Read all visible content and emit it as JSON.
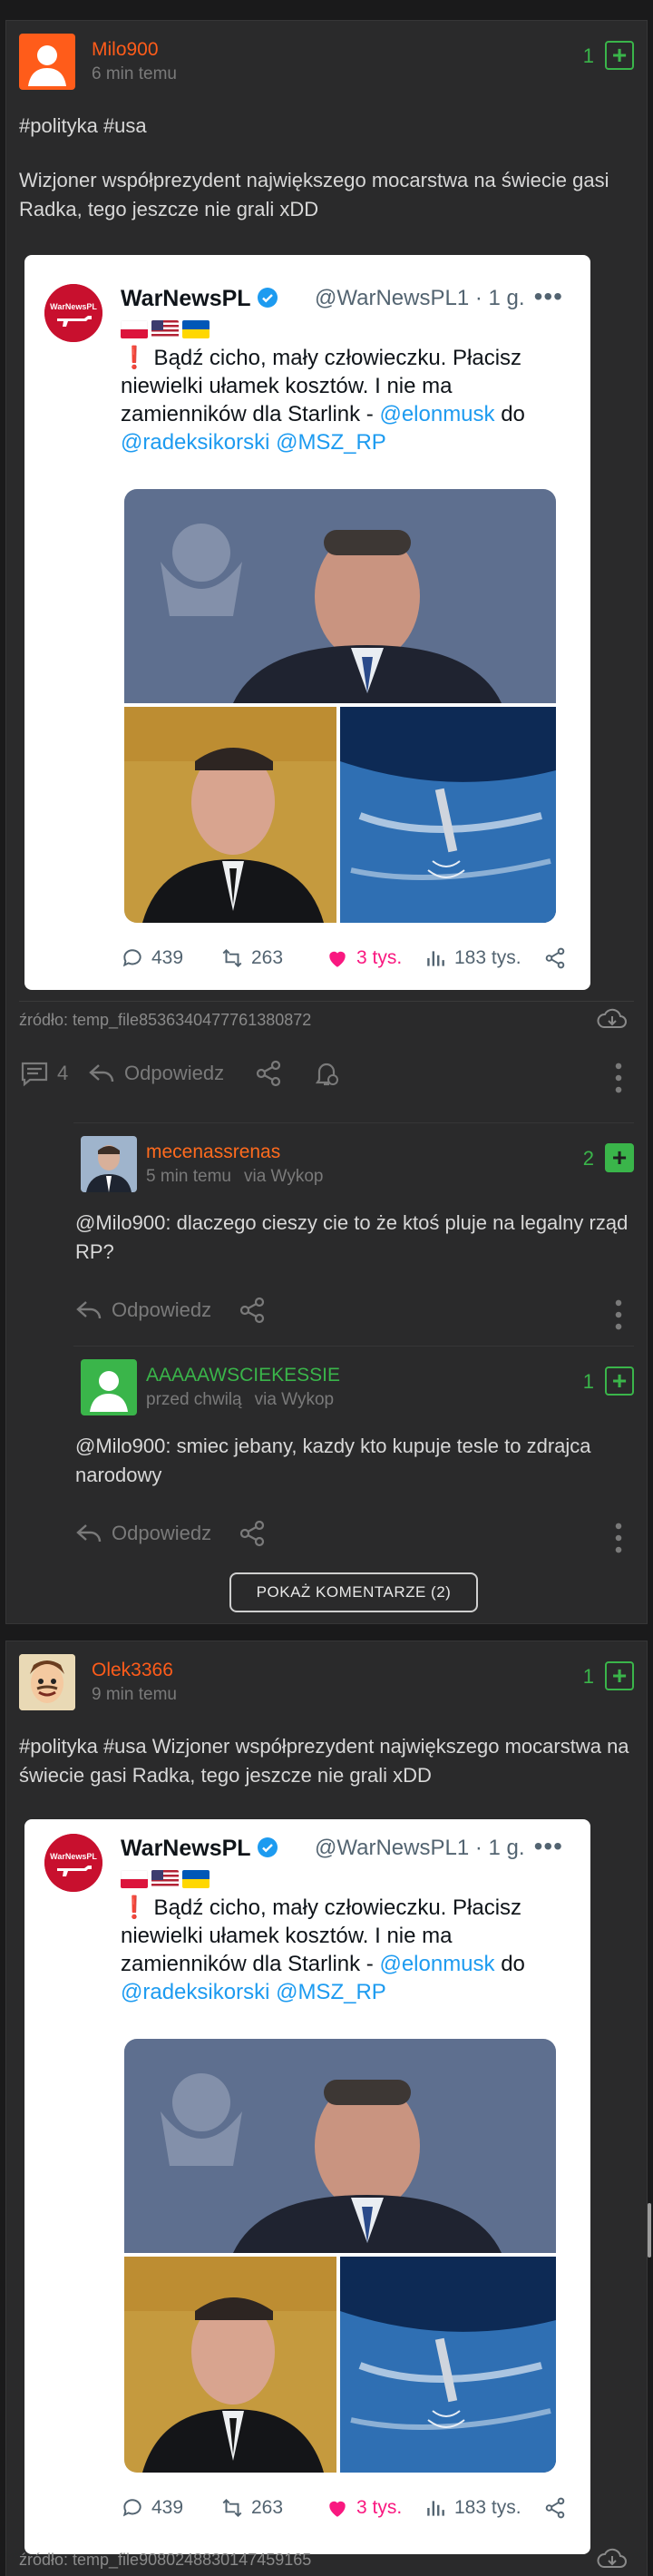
{
  "entries": [
    {
      "author": "Milo900",
      "time": "6 min temu",
      "votes": "1",
      "text_tags": "#polityka #usa",
      "text_body": "Wizjoner współprezydent największego mocarstwa na świecie gasi Radka, tego jeszcze nie grali xDD",
      "tweet": {
        "name": "WarNewsPL",
        "handle": "@WarNewsPL1 · 1 g.",
        "excl": "❗",
        "text_a": " Bądź cicho, mały człowieczku. Płacisz niewielki ułamek kosztów. I nie ma zamienników dla Starlink - ",
        "mention1": "@elonmusk",
        "text_b": " do ",
        "mention2": "@radeksikorski",
        "text_c": " ",
        "mention3": "@MSZ_RP",
        "replies": "439",
        "retweets": "263",
        "likes": "3 tys.",
        "views": "183 tys."
      },
      "source": "źródło: temp_file8536340477761380872",
      "comments_count": "4",
      "reply_label": "Odpowiedz",
      "comments": [
        {
          "author": "mecenassrenas",
          "time": "5 min temu",
          "via": "via Wykop",
          "votes": "2",
          "text": "@Milo900: dlaczego cieszy cie to że ktoś pluje na legalny rząd RP?",
          "reply_label": "Odpowiedz"
        },
        {
          "author": "AAAAAWSCIEKESSIE",
          "time": "przed chwilą",
          "via": "via Wykop",
          "votes": "1",
          "text": "@Milo900: smiec jebany, kazdy kto kupuje tesle to zdrajca narodowy",
          "reply_label": "Odpowiedz"
        }
      ],
      "show_more": "POKAŻ KOMENTARZE (2)"
    },
    {
      "author": "Olek3366",
      "time": "9 min temu",
      "votes": "1",
      "text_body": "#polityka #usa Wizjoner współprezydent największego mocarstwa na świecie gasi Radka, tego jeszcze nie grali xDD",
      "tweet": {
        "name": "WarNewsPL",
        "handle": "@WarNewsPL1 · 1 g.",
        "excl": "❗",
        "text_a": " Bądź cicho, mały człowieczku. Płacisz niewielki ułamek kosztów. I nie ma zamienników dla Starlink - ",
        "mention1": "@elonmusk",
        "text_b": " do ",
        "mention2": "@radeksikorski",
        "text_c": " ",
        "mention3": "@MSZ_RP",
        "replies": "439",
        "retweets": "263",
        "likes": "3 tys.",
        "views": "183 tys."
      },
      "source": "źródło: temp_file9080248830147459165"
    }
  ],
  "colors": {
    "accent_orange": "#ff5c1a",
    "vote_green": "#3ab54a",
    "link_blue": "#1d9bf0",
    "like_pink": "#f91880"
  }
}
